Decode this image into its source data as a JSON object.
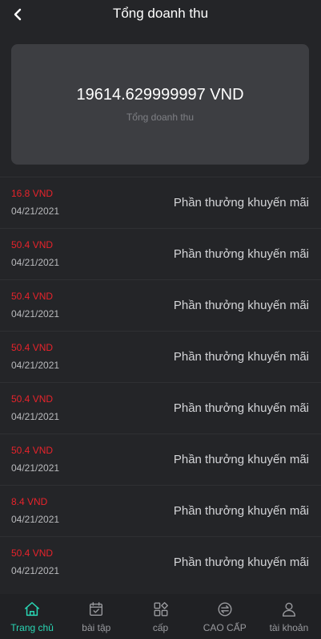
{
  "header": {
    "title": "Tổng doanh thu",
    "back_icon": "chevron-left-icon"
  },
  "summary": {
    "amount": "19614.629999997 VND",
    "label": "Tổng doanh thu"
  },
  "transactions": [
    {
      "amount": "16.8 VND",
      "date": "04/21/2021",
      "description": "Phần thưởng khuyến mãi"
    },
    {
      "amount": "50.4 VND",
      "date": "04/21/2021",
      "description": "Phần thưởng khuyến mãi"
    },
    {
      "amount": "50.4 VND",
      "date": "04/21/2021",
      "description": "Phần thưởng khuyến mãi"
    },
    {
      "amount": "50.4 VND",
      "date": "04/21/2021",
      "description": "Phần thưởng khuyến mãi"
    },
    {
      "amount": "50.4 VND",
      "date": "04/21/2021",
      "description": "Phần thưởng khuyến mãi"
    },
    {
      "amount": "50.4 VND",
      "date": "04/21/2021",
      "description": "Phần thưởng khuyến mãi"
    },
    {
      "amount": "8.4 VND",
      "date": "04/21/2021",
      "description": "Phần thưởng khuyến mãi"
    },
    {
      "amount": "50.4 VND",
      "date": "04/21/2021",
      "description": "Phần thưởng khuyến mãi"
    }
  ],
  "nav": {
    "items": [
      {
        "label": "Trang chủ",
        "icon": "home-icon",
        "active": true
      },
      {
        "label": "bài tập",
        "icon": "calendar-check-icon",
        "active": false
      },
      {
        "label": "cấp",
        "icon": "grid-icon",
        "active": false
      },
      {
        "label": "CAO CẤP",
        "icon": "exchange-icon",
        "active": false
      },
      {
        "label": "tài khoản",
        "icon": "user-icon",
        "active": false
      }
    ]
  },
  "colors": {
    "background": "#242528",
    "card": "#3d3e42",
    "amount_red": "#e8232b",
    "accent": "#29d6b4"
  }
}
